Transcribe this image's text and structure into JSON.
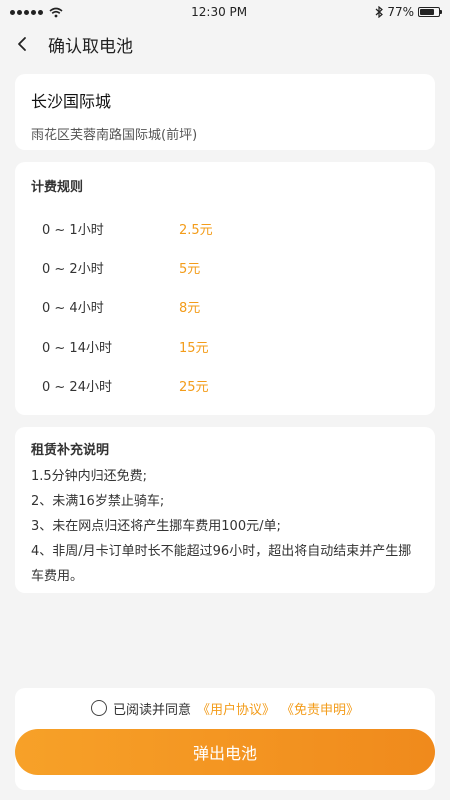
{
  "status_bar": {
    "time": "12:30 PM",
    "battery": "77%",
    "battery_level": 0.77,
    "bluetooth_icon": "bluetooth-icon",
    "wifi_icon": "wifi-icon"
  },
  "nav": {
    "back_icon": "chevron-left-icon",
    "title": "确认取电池"
  },
  "station": {
    "name": "长沙国际城",
    "address": "雨花区芙蓉南路国际城(前坪)"
  },
  "fee_rules": {
    "title": "计费规则",
    "rows": [
      {
        "duration": "0 ~ 1小时",
        "price": "2.5元"
      },
      {
        "duration": "0 ~ 2小时",
        "price": "5元"
      },
      {
        "duration": "0 ~ 4小时",
        "price": "8元"
      },
      {
        "duration": "0 ~ 14小时",
        "price": "15元"
      },
      {
        "duration": "0 ~ 24小时",
        "price": "25元"
      }
    ]
  },
  "notes": {
    "title": "租赁补充说明",
    "items": [
      "1.5分钟内归还免费;",
      "2、未满16岁禁止骑车;",
      "3、未在网点归还将产生挪车费用100元/单;",
      "4、非周/月卡订单时长不能超过96小时，超出将自动结束并产生挪车费用。"
    ]
  },
  "agreement": {
    "prefix": "已阅读并同意",
    "user_agreement": "《用户协议》",
    "disclaimer": "《免责申明》",
    "checked": false
  },
  "action": {
    "confirm_label": "弹出电池"
  },
  "colors": {
    "accent": "#f39c1a",
    "background": "#f4f4f4"
  }
}
